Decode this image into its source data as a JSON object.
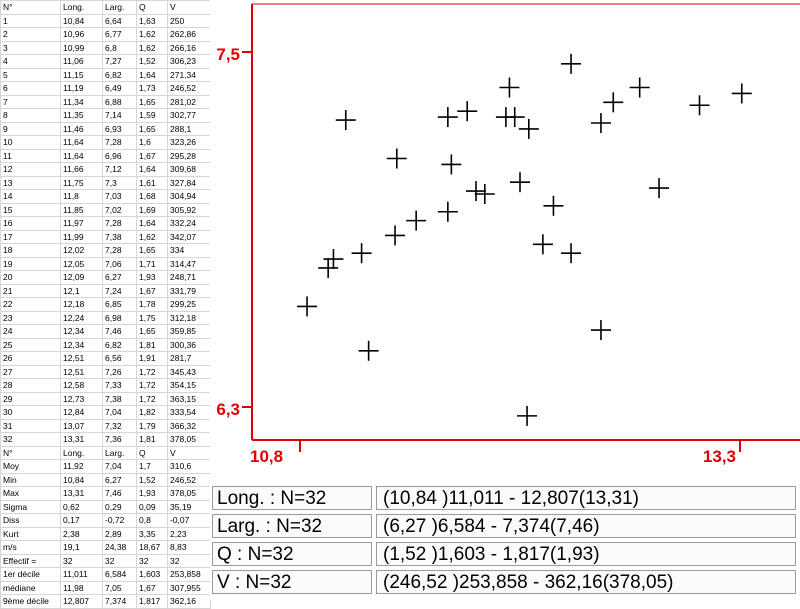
{
  "table": {
    "header": [
      "N°",
      "Long.",
      "Larg.",
      "Q",
      "V"
    ],
    "rows": [
      [
        "1",
        "10,84",
        "6,64",
        "1,63",
        "250"
      ],
      [
        "2",
        "10,96",
        "6,77",
        "1,62",
        "262,86"
      ],
      [
        "3",
        "10,99",
        "6,8",
        "1,62",
        "266,16"
      ],
      [
        "4",
        "11,06",
        "7,27",
        "1,52",
        "306,23"
      ],
      [
        "5",
        "11,15",
        "6,82",
        "1,64",
        "271,34"
      ],
      [
        "6",
        "11,19",
        "6,49",
        "1,73",
        "246,52"
      ],
      [
        "7",
        "11,34",
        "6,88",
        "1,65",
        "281,02"
      ],
      [
        "8",
        "11,35",
        "7,14",
        "1,59",
        "302,77"
      ],
      [
        "9",
        "11,46",
        "6,93",
        "1,65",
        "288,1"
      ],
      [
        "10",
        "11,64",
        "7,28",
        "1,6",
        "323,26"
      ],
      [
        "11",
        "11,64",
        "6,96",
        "1,67",
        "295,28"
      ],
      [
        "12",
        "11,66",
        "7,12",
        "1,64",
        "309,68"
      ],
      [
        "13",
        "11,75",
        "7,3",
        "1,61",
        "327,84"
      ],
      [
        "14",
        "11,8",
        "7,03",
        "1,68",
        "304,94"
      ],
      [
        "15",
        "11,85",
        "7,02",
        "1,69",
        "305,92"
      ],
      [
        "16",
        "11,97",
        "7,28",
        "1,64",
        "332,24"
      ],
      [
        "17",
        "11,99",
        "7,38",
        "1,62",
        "342,07"
      ],
      [
        "18",
        "12,02",
        "7,28",
        "1,65",
        "334"
      ],
      [
        "19",
        "12,05",
        "7,06",
        "1,71",
        "314,47"
      ],
      [
        "20",
        "12,09",
        "6,27",
        "1,93",
        "248,71"
      ],
      [
        "21",
        "12,1",
        "7,24",
        "1,67",
        "331,79"
      ],
      [
        "22",
        "12,18",
        "6,85",
        "1,78",
        "299,25"
      ],
      [
        "23",
        "12,24",
        "6,98",
        "1,75",
        "312,18"
      ],
      [
        "24",
        "12,34",
        "7,46",
        "1,65",
        "359,85"
      ],
      [
        "25",
        "12,34",
        "6,82",
        "1,81",
        "300,36"
      ],
      [
        "26",
        "12,51",
        "6,56",
        "1,91",
        "281,7"
      ],
      [
        "27",
        "12,51",
        "7,26",
        "1,72",
        "345,43"
      ],
      [
        "28",
        "12,58",
        "7,33",
        "1,72",
        "354,15"
      ],
      [
        "29",
        "12,73",
        "7,38",
        "1,72",
        "363,15"
      ],
      [
        "30",
        "12,84",
        "7,04",
        "1,82",
        "333,54"
      ],
      [
        "31",
        "13,07",
        "7,32",
        "1,79",
        "366,32"
      ],
      [
        "32",
        "13,31",
        "7,36",
        "1,81",
        "378,05"
      ]
    ],
    "header2": [
      "N°",
      "Long.",
      "Larg.",
      "Q",
      "V"
    ],
    "summary": [
      [
        "Moy",
        "11,92",
        "7,04",
        "1,7",
        "310,6"
      ],
      [
        "Min",
        "10,84",
        "6,27",
        "1,52",
        "246,52"
      ],
      [
        "Max",
        "13,31",
        "7,46",
        "1,93",
        "378,05"
      ],
      [
        "Sigma",
        "0,62",
        "0,29",
        "0,09",
        "35,19"
      ],
      [
        "Diss",
        "0,17",
        "-0,72",
        "0,8",
        "-0,07"
      ],
      [
        "Kurt",
        "2,38",
        "2,89",
        "3,35",
        "2,23"
      ],
      [
        "m/s",
        "19,1",
        "24,38",
        "18,67",
        "8,83"
      ],
      [
        "Effectif =",
        "32",
        "32",
        "32",
        "32"
      ],
      [
        "1er décile",
        "11,011",
        "6,584",
        "1,603",
        "253,858"
      ],
      [
        "médiane",
        "11,98",
        "7,05",
        "1,67",
        "307,955"
      ],
      [
        "9ème décile",
        "12,807",
        "7,374",
        "1,817",
        "362,16"
      ]
    ]
  },
  "chart": {
    "x_min_label": "10,8",
    "x_max_label": "13,3",
    "y_min_label": "6,3",
    "y_max_label": "7,5",
    "axis_color": "#e00000",
    "label_color": "#e00000",
    "marker_color": "#000000"
  },
  "chart_data": {
    "type": "scatter",
    "title": "",
    "xlabel": "",
    "ylabel": "",
    "xlim": [
      10.8,
      13.3
    ],
    "ylim": [
      6.3,
      7.5
    ],
    "x_ticks": [
      "10,8",
      "13,3"
    ],
    "y_ticks": [
      "6,3",
      "7,5"
    ],
    "series": [
      {
        "x": [
          10.84,
          10.96,
          10.99,
          11.06,
          11.15,
          11.19,
          11.34,
          11.35,
          11.46,
          11.64,
          11.64,
          11.66,
          11.75,
          11.8,
          11.85,
          11.97,
          11.99,
          12.02,
          12.05,
          12.09,
          12.1,
          12.18,
          12.24,
          12.34,
          12.34,
          12.51,
          12.51,
          12.58,
          12.73,
          12.84,
          13.07,
          13.31
        ],
        "y": [
          6.64,
          6.77,
          6.8,
          7.27,
          6.82,
          6.49,
          6.88,
          7.14,
          6.93,
          7.28,
          6.96,
          7.12,
          7.3,
          7.03,
          7.02,
          7.28,
          7.38,
          7.28,
          7.06,
          6.27,
          7.24,
          6.85,
          6.98,
          7.46,
          6.82,
          6.56,
          7.26,
          7.33,
          7.38,
          7.04,
          7.32,
          7.36
        ]
      }
    ],
    "grid": false,
    "legend": "none"
  },
  "stats": [
    {
      "label": "Long. : N=32",
      "range": "(10,84 )11,011 - 12,807(13,31)"
    },
    {
      "label": "Larg. : N=32",
      "range": "(6,27 )6,584 - 7,374(7,46)"
    },
    {
      "label": "Q : N=32",
      "range": "(1,52 )1,603 - 1,817(1,93)"
    },
    {
      "label": "V : N=32",
      "range": "(246,52 )253,858 - 362,16(378,05)"
    }
  ]
}
